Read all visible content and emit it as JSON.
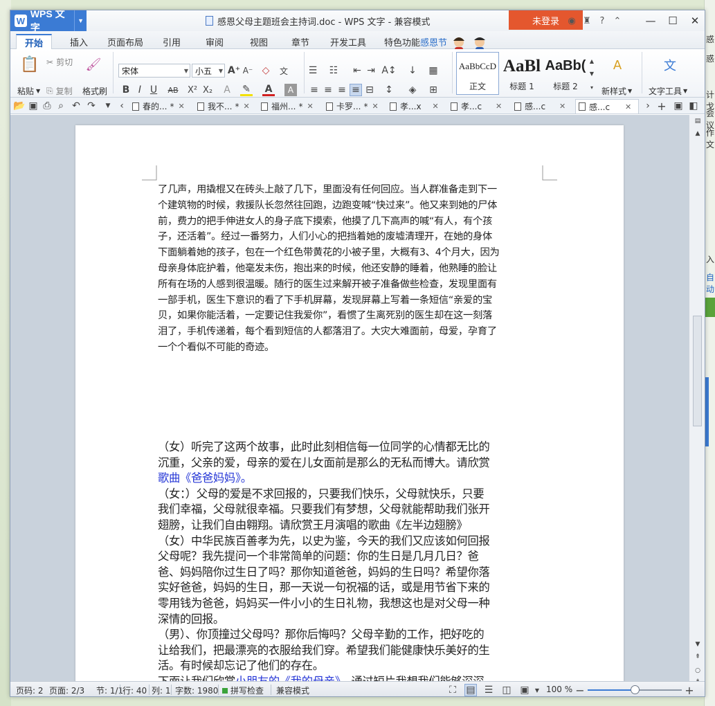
{
  "window": {
    "app_name": "WPS 文字",
    "doc_title": "感恩父母主题班会主持词.doc - WPS 文字 - 兼容模式",
    "login_label": "未登录"
  },
  "ribbon_tabs": [
    "开始",
    "插入",
    "页面布局",
    "引用",
    "审阅",
    "视图",
    "章节",
    "开发工具",
    "特色功能",
    "感恩节"
  ],
  "ribbon": {
    "paste": "粘贴",
    "cut": "剪切",
    "copy": "复制",
    "format_painter": "格式刷",
    "font_name": "宋体",
    "font_size": "小五",
    "styles": [
      {
        "sample": "AaBbCcD",
        "label": "正文"
      },
      {
        "sample": "AaBl",
        "label": "标题 1"
      },
      {
        "sample": "AaBb(",
        "label": "标题 2"
      }
    ],
    "new_style": "新样式",
    "text_tools": "文字工具"
  },
  "doc_tabs": [
    {
      "label": "春的...",
      "marker": "*"
    },
    {
      "label": "我不...",
      "marker": "*"
    },
    {
      "label": "福州...",
      "marker": "*"
    },
    {
      "label": "卡罗...",
      "marker": "*"
    },
    {
      "label": "孝...x",
      "marker": ""
    },
    {
      "label": "孝...c",
      "marker": ""
    },
    {
      "label": "感...c",
      "marker": ""
    },
    {
      "label": "感...c",
      "marker": ""
    }
  ],
  "document": {
    "para1_lines": [
      "了几声，用撬棍又在砖头上敲了几下，里面没有任何回应。当人群准备走到下一",
      "个建筑物的时候，救援队长忽然往回跑，边跑变喊“快过来”。他又来到她的尸体",
      "前，费力的把手伸进女人的身子底下摸索，他摸了几下高声的喊“有人，有个孩",
      "子，还活着”。经过一番努力，人们小心的把挡着她的废墟清理开，在她的身体",
      "下面躺着她的孩子，包在一个红色带黄花的小被子里，大概有3、4个月大，因为",
      "母亲身体庇护着，他毫发未伤，抱出来的时候，他还安静的睡着，他熟睡的脸让",
      "所有在场的人感到很温暖。随行的医生过来解开被子准备做些检查，发现里面有",
      "一部手机，医生下意识的看了下手机屏幕，发现屏幕上写着一条短信“亲爱的宝",
      "贝，如果你能活着，一定要记住我爱你”，看惯了生离死别的医生却在这一刻落",
      "泪了，手机传递着，每个看到短信的人都落泪了。大灾大难面前，母爱，孕育了",
      "一个个看似不可能的奇迹。"
    ],
    "para2_lines": [
      "（女）听完了这两个故事，此时此刻相信每一位同学的心情都无比的",
      "沉重，父亲的爱，母亲的爱在儿女面前是那么的无私而博大。请欣赏"
    ],
    "song1": "歌曲《爸爸妈妈》。",
    "para3_lines": [
      "（女：）父母的爱是不求回报的，只要我们快乐，父母就快乐，只要",
      "我们幸福，父母就很幸福。只要我们有梦想，父母就能帮助我们张开",
      "翅膀，让我们自由翱翔。请欣赏王月演唱的歌曲《左半边翅膀》",
      "（女）中华民族百善孝为先，以史为鉴，今天的我们又应该如何回报",
      "父母呢？我先提问一个非常简单的问题：你的生日是几月几日？爸",
      "爸、妈妈陪你过生日了吗？那你知道爸爸，妈妈的生日吗？希望你落",
      "实好爸爸，妈妈的生日，那一天说一句祝福的话，或是用节省下来的",
      "零用钱为爸爸，妈妈买一件小小的生日礼物，我想这也是对父母一种",
      "深情的回报。",
      "（男）、你顶撞过父母吗？那你后悔吗？父母辛勤的工作，把好吃的",
      "让给我们，把最漂亮的衣服给我们穿。希望我们能健康快乐美好的生",
      "活。有时候却忘记了他们的存在。"
    ],
    "last_line_start": "下面让我们欣赏",
    "last_line_blue": "小朋友的《我的母亲》",
    "last_line_end": "，通过短片我想我们能够深深"
  },
  "status": {
    "page": "页码: 2",
    "pages": "页面: 2/3",
    "section": "节: 1/1",
    "row": "行: 40",
    "col": "列: 1",
    "words": "字数: 1980",
    "spell": "拼写检查",
    "compat": "兼容模式",
    "zoom": "100 %",
    "zoom_level": 0.5
  },
  "colors": {
    "accent": "#3b7bd4",
    "login": "#e4572e",
    "link_blue": "#2536d6"
  }
}
